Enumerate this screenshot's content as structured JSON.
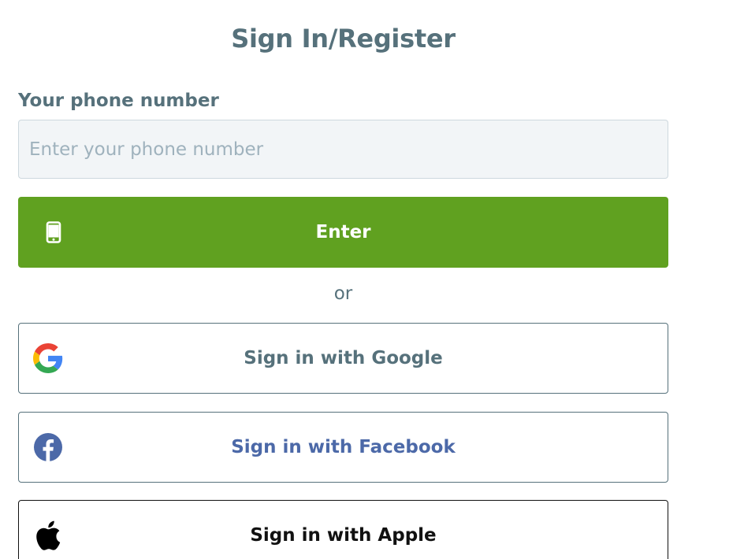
{
  "header": {
    "title": "Sign In/Register"
  },
  "phone": {
    "label": "Your phone number",
    "placeholder": "Enter your phone number",
    "value": ""
  },
  "enter_button": {
    "label": "Enter",
    "icon": "mobile-phone-icon"
  },
  "divider": {
    "text": "or"
  },
  "social": {
    "google": {
      "label": "Sign in with Google",
      "icon": "google-icon"
    },
    "facebook": {
      "label": "Sign in with Facebook",
      "icon": "facebook-icon"
    },
    "apple": {
      "label": "Sign in with Apple",
      "icon": "apple-icon"
    }
  },
  "colors": {
    "primary_green": "#60a120",
    "text_slate": "#56717b",
    "facebook_blue": "#4c69a8",
    "input_background": "#f2f5f7"
  }
}
